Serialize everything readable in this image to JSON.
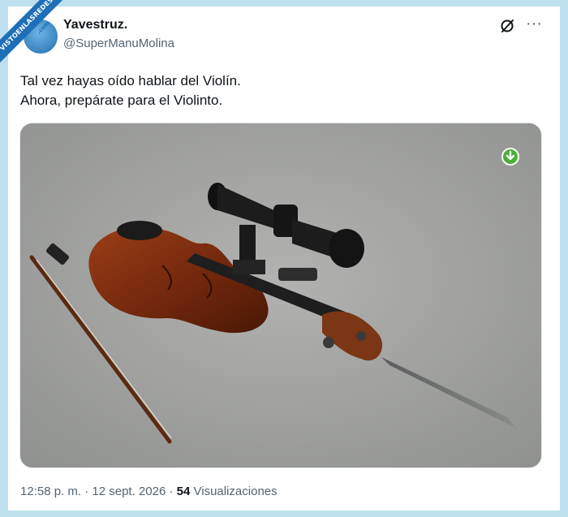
{
  "watermark": {
    "text": "VISTOENLASREDES",
    "sub": ".com"
  },
  "author": {
    "display_name": "Yavestruz.",
    "handle": "@SuperManuMolina"
  },
  "tweet": {
    "lines": [
      "Tal vez hayas oído hablar del Violín.",
      "Ahora, prepárate para el Violinto."
    ]
  },
  "media": {
    "description_icon": "download-arrow-icon"
  },
  "meta": {
    "time": "12:58 p. m.",
    "sep1": " · ",
    "date": "12 sept. 2026",
    "sep2": " · ",
    "views_count": "54",
    "views_label": " Visualizaciones"
  },
  "colors": {
    "frame": "#bfe0ef",
    "text": "#0f1419",
    "muted": "#536471",
    "badge_green": "#4cae3a"
  }
}
